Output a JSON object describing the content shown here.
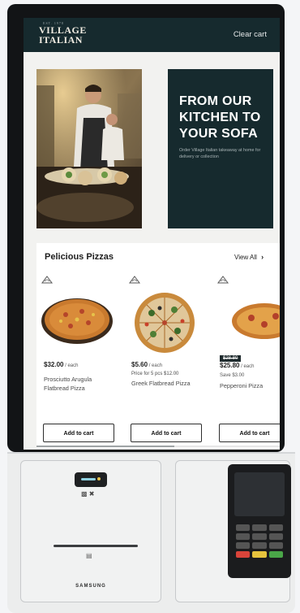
{
  "header": {
    "logo_small": "EST. 1978",
    "logo_line1": "VILLAGE",
    "logo_line2": "ITALIAN",
    "clear_cart_label": "Clear cart"
  },
  "hero": {
    "title": "FROM OUR KITCHEN TO YOUR SOFA",
    "subtitle": "Order Village Italian takeaway at home for delivery or collection"
  },
  "products_section": {
    "title": "Pelicious Pizzas",
    "view_all_label": "View All"
  },
  "products": [
    {
      "price": "$32.00",
      "per": " / each",
      "name": "Prosciutto Arugula Flatbread Pizza",
      "add_label": "Add to cart"
    },
    {
      "price": "$5.60",
      "per": " / each",
      "multi_price": "Price for 5 pcs $12.00",
      "name": "Greek Flatbread Pizza",
      "add_label": "Add to cart"
    },
    {
      "old_price": "$28.80",
      "price": "$25.80",
      "per": " / each",
      "save": "Save $3.00",
      "name": "Pepperoni Pizza",
      "add_label": "Add to cart"
    }
  ],
  "hardware": {
    "brand": "SAMSUNG"
  },
  "colors": {
    "header_bg": "#162a2e",
    "panel_bg": "#162a2e",
    "kiosk_frame": "#121416"
  }
}
